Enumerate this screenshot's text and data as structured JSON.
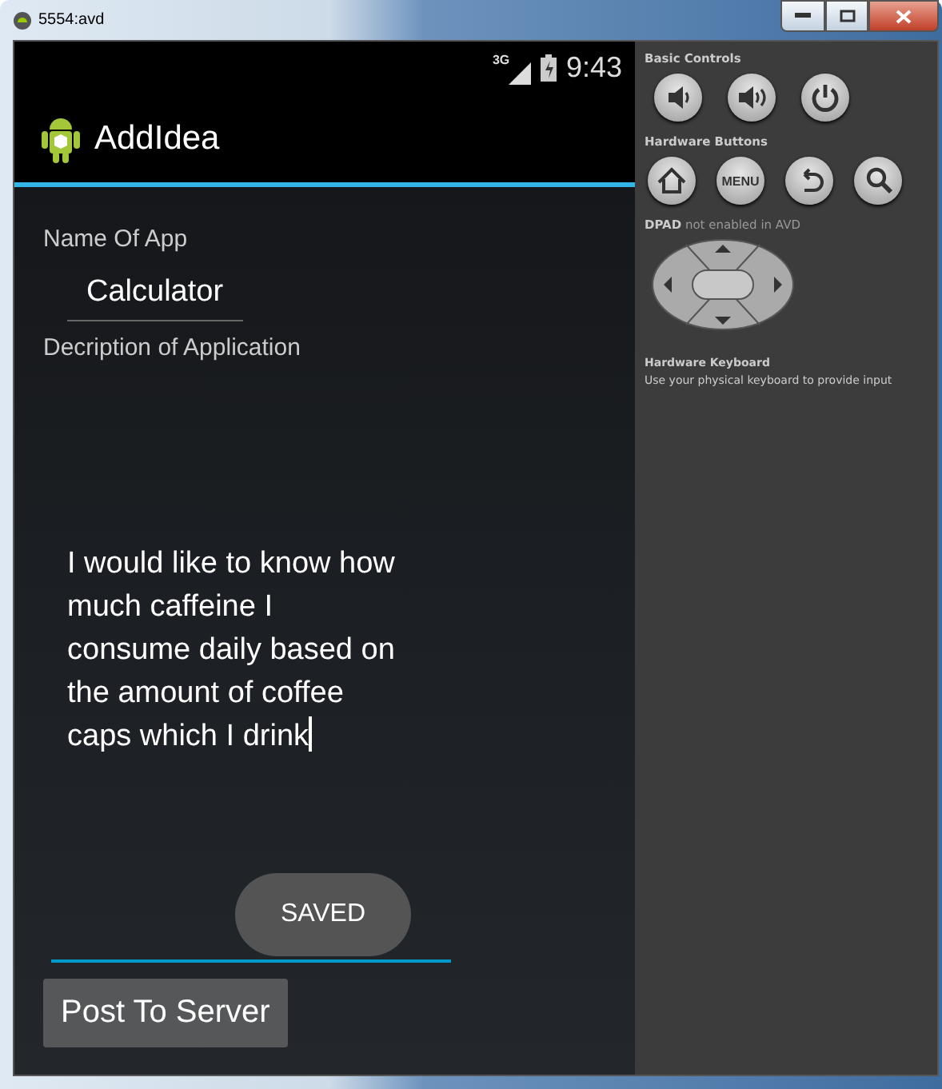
{
  "window": {
    "title": "5554:avd"
  },
  "status_bar": {
    "network": "3G",
    "time": "9:43"
  },
  "action_bar": {
    "title": "AddIdea"
  },
  "form": {
    "name_label": "Name Of App",
    "name_value": "Calculator",
    "description_label": "Decription of Application",
    "description_value": "I would like to know how much caffeine I consume daily based on the amount of coffee caps which I drink",
    "description_focused": true
  },
  "toast": "SAVED",
  "buttons": [
    {
      "label": "Post To Server"
    }
  ],
  "controls": {
    "basic_title": "Basic Controls",
    "basic": [
      {
        "kind": "volume-down"
      },
      {
        "kind": "volume-up"
      },
      {
        "kind": "power"
      }
    ],
    "hardware_title": "Hardware Buttons",
    "hardware": [
      {
        "kind": "home"
      },
      {
        "kind": "menu",
        "label": "MENU"
      },
      {
        "kind": "back"
      },
      {
        "kind": "search"
      }
    ],
    "dpad_note": "**DPAD** not enabled in AVD",
    "keyboard_title": "Hardware Keyboard",
    "keyboard_note": "Use your physical keyboard to provide input"
  }
}
